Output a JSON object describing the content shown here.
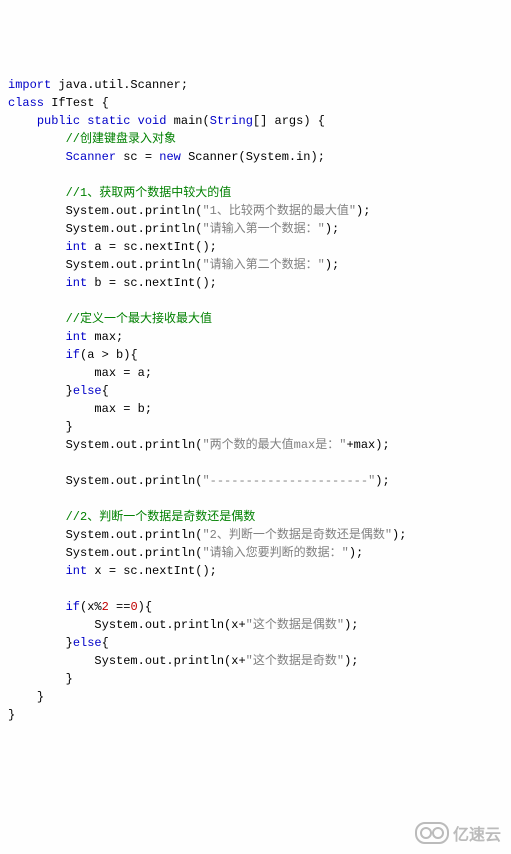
{
  "l1": {
    "kw_import": "import",
    "pkg": "java.util.Scanner",
    "semi": ";"
  },
  "l2": {
    "kw_class": "class",
    "name": "IfTest",
    "brace": "{"
  },
  "l3": {
    "kw_public": "public",
    "kw_static": "static",
    "kw_void": "void",
    "main": "main",
    "paren_open": "(",
    "type": "String",
    "arr": "[]",
    "arg": "args",
    "paren_close": ")",
    "brace": "{"
  },
  "c1": "//创建键盘录入对象",
  "l5": {
    "type": "Scanner",
    "var": "sc",
    "eq": "=",
    "kw_new": "new",
    "ctor": "Scanner",
    "po": "(",
    "sysin": "System.in",
    "pc": ")",
    "semi": ";"
  },
  "c2": "//1、获取两个数据中较大的值",
  "l8": {
    "call": "System.out.println",
    "po": "(",
    "str": "\"1、比较两个数据的最大值\"",
    "pc": ")",
    "semi": ";"
  },
  "l9": {
    "call": "System.out.println",
    "po": "(",
    "str": "\"请输入第一个数据：\"",
    "pc": ")",
    "semi": ";"
  },
  "l10": {
    "kw_int": "int",
    "var": "a",
    "eq": "=",
    "expr": "sc.nextInt()",
    "semi": ";"
  },
  "l11": {
    "call": "System.out.println",
    "po": "(",
    "str": "\"请输入第二个数据：\"",
    "pc": ")",
    "semi": ";"
  },
  "l12": {
    "kw_int": "int",
    "var": "b",
    "eq": "=",
    "expr": "sc.nextInt()",
    "semi": ";"
  },
  "c3": "//定义一个最大接收最大值",
  "l15": {
    "kw_int": "int",
    "var": "max",
    "semi": ";"
  },
  "l16": {
    "kw_if": "if",
    "po": "(",
    "cond": "a > b",
    "pc": ")",
    "brace": "{"
  },
  "l17": {
    "stmt": "max = a;"
  },
  "l18": {
    "close": "}",
    "kw_else": "else",
    "brace": "{"
  },
  "l19": {
    "stmt": "max = b;"
  },
  "l20": {
    "close": "}"
  },
  "l21": {
    "call": "System.out.println",
    "po": "(",
    "str": "\"两个数的最大值max是：\"",
    "plus": "+",
    "var": "max",
    "pc": ")",
    "semi": ";"
  },
  "l23": {
    "call": "System.out.println",
    "po": "(",
    "str": "\"----------------------\"",
    "pc": ")",
    "semi": ";"
  },
  "c4": "//2、判断一个数据是奇数还是偶数",
  "l26": {
    "call": "System.out.println",
    "po": "(",
    "str": "\"2、判断一个数据是奇数还是偶数\"",
    "pc": ")",
    "semi": ";"
  },
  "l27": {
    "call": "System.out.println",
    "po": "(",
    "str": "\"请输入您要判断的数据：\"",
    "pc": ")",
    "semi": ";"
  },
  "l28": {
    "kw_int": "int",
    "var": "x",
    "eq": "=",
    "expr": "sc.nextInt()",
    "semi": ";"
  },
  "l30": {
    "kw_if": "if",
    "po": "(",
    "cond_a": "x%",
    "cond_num": "2",
    "cond_b": " ==",
    "cond_zero": "0",
    "pc": ")",
    "brace": "{"
  },
  "l31": {
    "call": "System.out.println",
    "po": "(",
    "var": "x",
    "plus": "+",
    "str": "\"这个数据是偶数\"",
    "pc": ")",
    "semi": ";"
  },
  "l32": {
    "close": "}",
    "kw_else": "else",
    "brace": "{"
  },
  "l33": {
    "call": "System.out.println",
    "po": "(",
    "var": "x",
    "plus": "+",
    "str": "\"这个数据是奇数\"",
    "pc": ")",
    "semi": ";"
  },
  "l34": {
    "close": "}"
  },
  "l35": {
    "close": "}"
  },
  "l36": {
    "close": "}"
  },
  "watermark": "亿速云"
}
